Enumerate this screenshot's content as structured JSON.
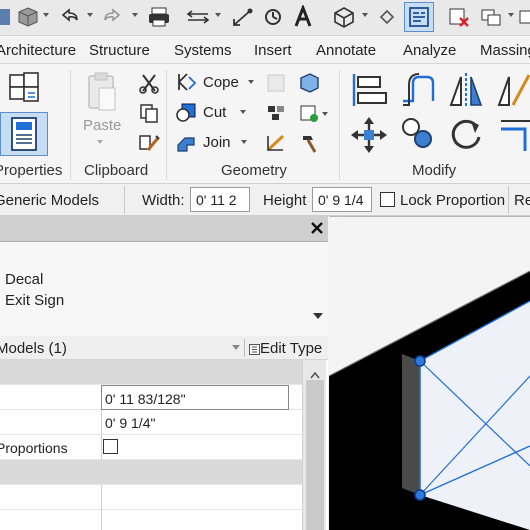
{
  "tabs": [
    "Architecture",
    "Structure",
    "Systems",
    "Insert",
    "Annotate",
    "Analyze",
    "Massing"
  ],
  "ribbon": {
    "panels": {
      "properties": "Properties",
      "clipboard": "Clipboard",
      "geometry": "Geometry",
      "modify": "Modify"
    },
    "clipboard": {
      "paste": "Paste"
    },
    "geometry": {
      "cope": "Cope",
      "cut": "Cut",
      "join": "Join"
    }
  },
  "options_bar": {
    "family_label": "Generic Models",
    "width_label": "Width:",
    "width_value": "0'  11 2",
    "height_label": "Height",
    "height_value": "0'  9 1/4",
    "lock_label": "Lock Proportion",
    "trailing_label": "Re"
  },
  "properties": {
    "type_family": "Decal",
    "type_name": "Exit Sign",
    "instance_filter": "Models (1)",
    "edit_type": "Edit Type",
    "rows": [
      {
        "kind": "category",
        "name": "",
        "value": ""
      },
      {
        "kind": "param",
        "name": "",
        "value": "0'  11 83/128\""
      },
      {
        "kind": "param",
        "name": "",
        "value": "0'  9 1/4\""
      },
      {
        "kind": "param",
        "name": "Proportions",
        "value": ""
      },
      {
        "kind": "category",
        "name": "",
        "value": ""
      },
      {
        "kind": "param",
        "name": "",
        "value": ""
      },
      {
        "kind": "param",
        "name": "",
        "value": ""
      }
    ]
  },
  "colors": {
    "accent": "#1f6fd6",
    "selected_btn": "#c7ddf3",
    "viewport_bg": "#000000"
  }
}
